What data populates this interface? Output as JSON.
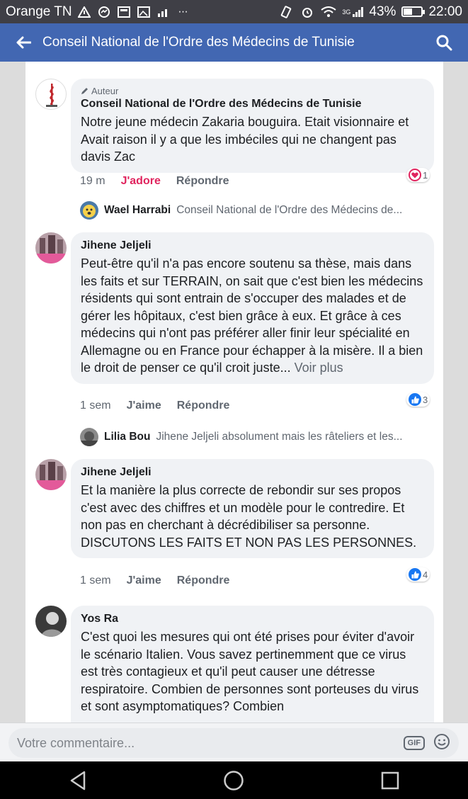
{
  "status_bar": {
    "carrier": "Orange TN",
    "network": "3G",
    "battery": "43%",
    "battery_level": 0.43,
    "time": "22:00"
  },
  "app_bar": {
    "title": "Conseil National de l'Ordre des Médecins de Tunisie"
  },
  "comments": [
    {
      "author_badge": "Auteur",
      "name": "Conseil National de l'Ordre des Médecins de Tunisie",
      "text": "Notre jeune médecin Zakaria bouguira. Etait visionnaire et Avait raison il y a que les imbéciles qui ne changent pas davis Zac",
      "time": "19 m",
      "reaction_label": "J'adore",
      "reply_label": "Répondre",
      "reaction_count": "1",
      "reply_preview": {
        "name": "Wael Harrabi",
        "text": "Conseil National de l'Ordre des Médecins de..."
      }
    },
    {
      "name": "Jihene Jeljeli",
      "text": "Peut-être qu'il n'a pas encore soutenu sa thèse, mais dans les faits et sur TERRAIN, on sait que c'est bien les médecins résidents qui sont entrain de s'occuper des malades et de gérer les hôpitaux, c'est bien grâce à eux. Et grâce à ces médecins qui n'ont pas préférer aller finir leur spécialité en Allemagne ou en France pour échapper à la misère. Il a bien le droit de penser ce qu'il croit juste...",
      "see_more": "Voir plus",
      "time": "1 sem",
      "reaction_label": "J'aime",
      "reply_label": "Répondre",
      "reaction_count": "3",
      "reply_preview": {
        "name": "Lilia Bou",
        "text": "Jihene Jeljeli absolument mais les râteliers et les..."
      }
    },
    {
      "name": "Jihene Jeljeli",
      "text": "Et la manière la plus correcte de rebondir sur ses propos c'est avec des chiffres et un modèle pour le contredire. Et non pas en cherchant à décrédibiliser sa personne. DISCUTONS LES FAITS ET NON PAS LES PERSONNES.",
      "time": "1 sem",
      "reaction_label": "J'aime",
      "reply_label": "Répondre",
      "reaction_count": "4"
    },
    {
      "name": "Yos Ra",
      "text": "C'est quoi les mesures qui ont été prises pour éviter d'avoir le scénario Italien. Vous savez pertinemment que ce virus est très contagieux et qu'il peut causer une détresse respiratoire. Combien de personnes sont porteuses du virus et sont asymptomatiques? Combien"
    }
  ],
  "compose": {
    "placeholder": "Votre commentaire...",
    "gif_label": "GIF"
  },
  "colors": {
    "brand": "#4267b2",
    "love": "#e0245e",
    "like": "#1877f2"
  }
}
